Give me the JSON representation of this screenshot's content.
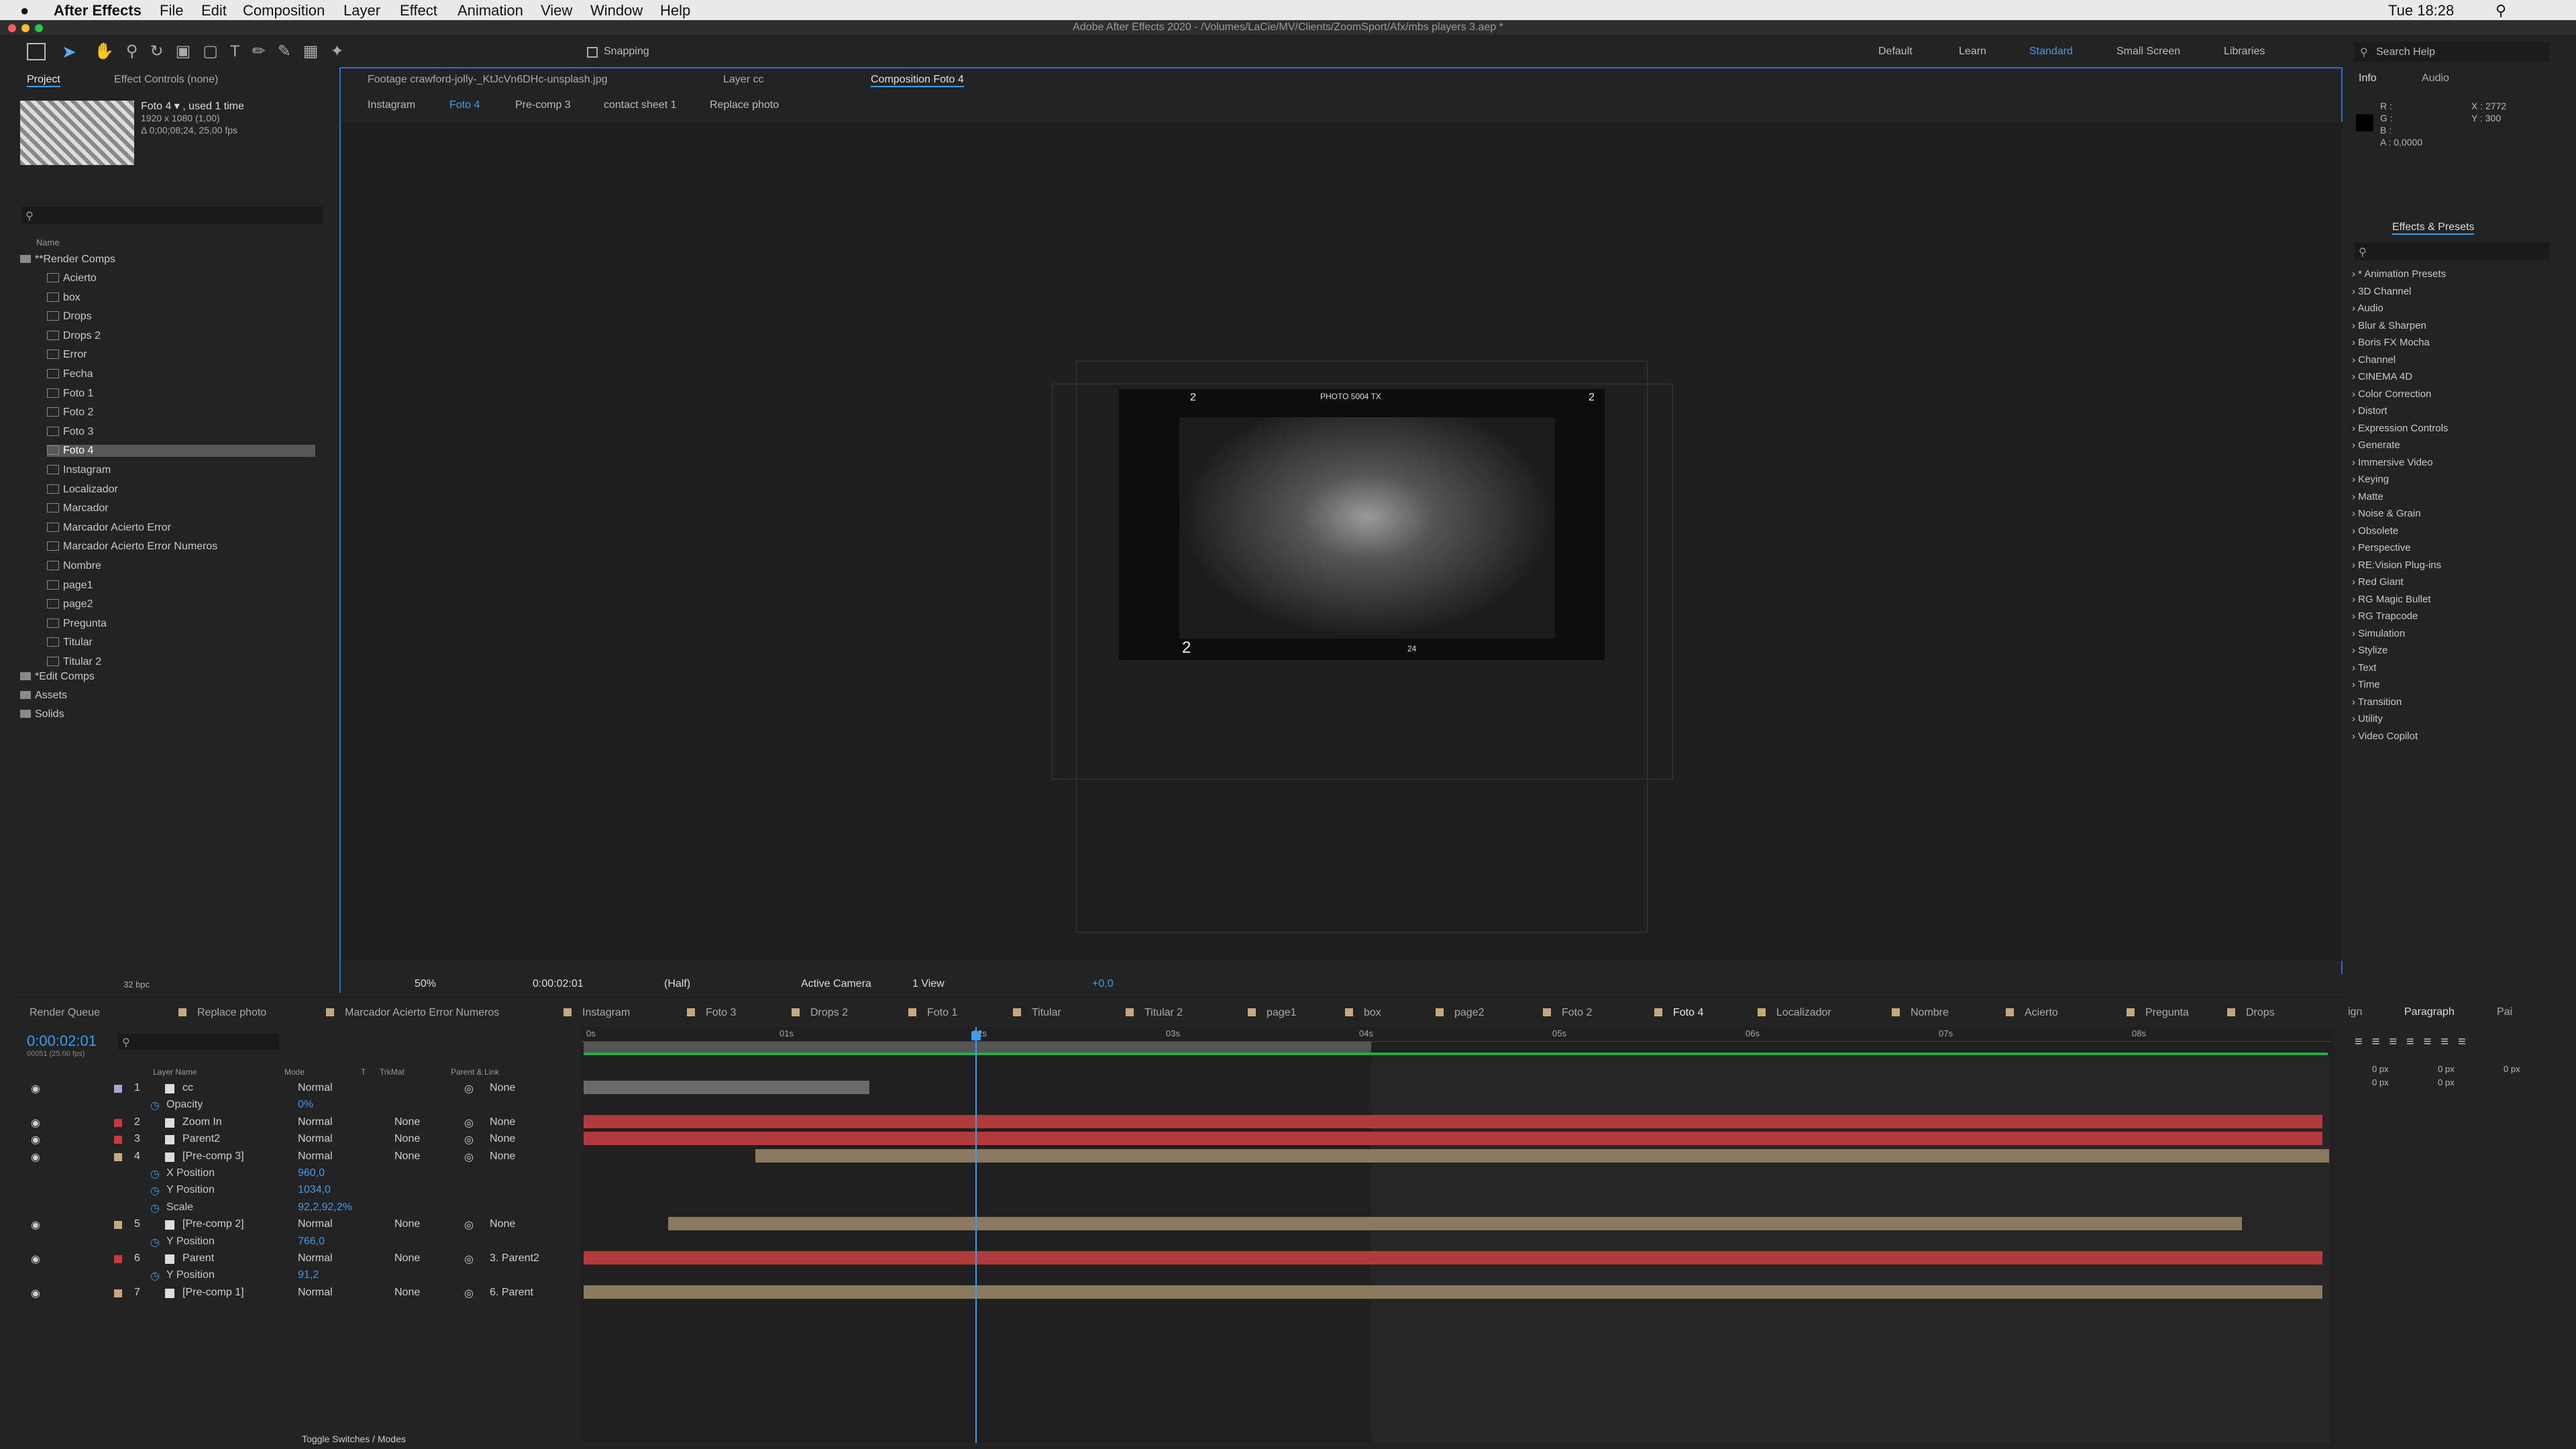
{
  "menubar": {
    "apple": "",
    "app": "After Effects",
    "items": [
      "File",
      "Edit",
      "Composition",
      "Layer",
      "Effect",
      "Animation",
      "View",
      "Window",
      "Help"
    ],
    "clock": "Tue 18:28"
  },
  "title": "Adobe After Effects 2020 - /Volumes/LaCie/MV/Clients/ZoomSport/Afx/mbs players 3.aep *",
  "toolbar": {
    "snapping": "Snapping",
    "workspaces": [
      "Default",
      "Learn",
      "Standard",
      "Small Screen",
      "Libraries"
    ],
    "search": "Search Help"
  },
  "project": {
    "tab_project": "Project",
    "tab_effects": "Effect Controls (none)",
    "thumb_name": "Foto 4 ▾ , used 1 time",
    "thumb_res": "1920 x 1080 (1,00)",
    "thumb_dur": "Δ 0;00;08;24, 25,00 fps",
    "col_name": "Name",
    "folder_render": "**Render Comps",
    "items": [
      "Acierto",
      "box",
      "Drops",
      "Drops 2",
      "Error",
      "Fecha",
      "Foto 1",
      "Foto 2",
      "Foto 3",
      "Foto 4",
      "Instagram",
      "Localizador",
      "Marcador",
      "Marcador Acierto Error",
      "Marcador Acierto Error Numeros",
      "Nombre",
      "page1",
      "page2",
      "Pregunta",
      "Titular",
      "Titular 2"
    ],
    "folders": [
      "*Edit Comps",
      "Assets",
      "Solids"
    ],
    "bpc": "32 bpc"
  },
  "viewer": {
    "tabs": [
      "Footage crawford-jolly-_KtJcVn6DHc-unsplash.jpg",
      "Layer cc",
      "Composition Foto 4"
    ],
    "breadcrumb": [
      "Instagram",
      "Foto 4",
      "Pre-comp 3",
      "contact sheet 1",
      "Replace photo"
    ],
    "zoom": "50%",
    "time": "0:00:02:01",
    "res": "(Half)",
    "camera": "Active Camera",
    "view": "1 View",
    "exposure": "+0,0",
    "photo_text": "PHOTO  5004  TX",
    "num_a": "2",
    "num_b": "2",
    "num_c": "2",
    "num_d": "24"
  },
  "info": {
    "tab_info": "Info",
    "tab_audio": "Audio",
    "rgba": [
      "R :",
      "G :",
      "B :",
      "A :  0,0000"
    ],
    "x": "X : 2772",
    "y": "Y : 300"
  },
  "effects": {
    "title": "Effects & Presets",
    "list": [
      "* Animation Presets",
      "3D Channel",
      "Audio",
      "Blur & Sharpen",
      "Boris FX Mocha",
      "Channel",
      "CINEMA 4D",
      "Color Correction",
      "Distort",
      "Expression Controls",
      "Generate",
      "Immersive Video",
      "Keying",
      "Matte",
      "Noise & Grain",
      "Obsolete",
      "Perspective",
      "RE:Vision Plug-ins",
      "Red Giant",
      "RG Magic Bullet",
      "RG Trapcode",
      "Simulation",
      "Stylize",
      "Text",
      "Time",
      "Transition",
      "Utility",
      "Video Copilot"
    ]
  },
  "timeline": {
    "tabs": [
      "Render Queue",
      "Replace photo",
      "Marcador Acierto Error Numeros",
      "Instagram",
      "Foto 3",
      "Drops 2",
      "Foto 1",
      "Titular",
      "Titular 2",
      "page1",
      "box",
      "page2",
      "Foto 2",
      "Foto 4",
      "Localizador",
      "Nombre",
      "Acierto",
      "Pregunta",
      "Drops"
    ],
    "timecode": "0:00:02:01",
    "frames": "00051 (25.00 fps)",
    "cols": {
      "layer": "Layer Name",
      "mode": "Mode",
      "t": "T",
      "trk": "TrkMat",
      "parent": "Parent & Link"
    },
    "ruler": [
      "0s",
      "01s",
      "02s",
      "03s",
      "04s",
      "05s",
      "06s",
      "07s",
      "08s"
    ],
    "toggle": "Toggle Switches / Modes",
    "rows": [
      {
        "num": "1",
        "name": "cc",
        "mode": "Normal",
        "trk": "",
        "parent": "None",
        "color": "#a8a8c8"
      },
      {
        "prop": "Opacity",
        "val": "0%"
      },
      {
        "num": "2",
        "name": "Zoom In",
        "mode": "Normal",
        "trk": "None",
        "parent": "None",
        "color": "#c83a3a"
      },
      {
        "num": "3",
        "name": "Parent2",
        "mode": "Normal",
        "trk": "None",
        "parent": "None",
        "color": "#c83a3a"
      },
      {
        "num": "4",
        "name": "[Pre-comp 3]",
        "mode": "Normal",
        "trk": "None",
        "parent": "None",
        "color": "#c8a878"
      },
      {
        "prop": "X Position",
        "val": "960,0"
      },
      {
        "prop": "Y Position",
        "val": "1034,0"
      },
      {
        "prop": "Scale",
        "val": "92,2,92,2%"
      },
      {
        "num": "5",
        "name": "[Pre-comp 2]",
        "mode": "Normal",
        "trk": "None",
        "parent": "None",
        "color": "#c8a878"
      },
      {
        "prop": "Y Position",
        "val": "766,0"
      },
      {
        "num": "6",
        "name": "Parent",
        "mode": "Normal",
        "trk": "None",
        "parent": "3. Parent2",
        "color": "#c83a3a"
      },
      {
        "prop": "Y Position",
        "val": "91,2"
      },
      {
        "num": "7",
        "name": "[Pre-comp 1]",
        "mode": "Normal",
        "trk": "None",
        "parent": "6. Parent",
        "color": "#c8a878"
      }
    ]
  },
  "paragraph": {
    "tabs": [
      "ign",
      "Paragraph",
      "Pai"
    ],
    "px": [
      "0 px",
      "0 px",
      "0 px",
      "0 px",
      "0 px"
    ]
  }
}
